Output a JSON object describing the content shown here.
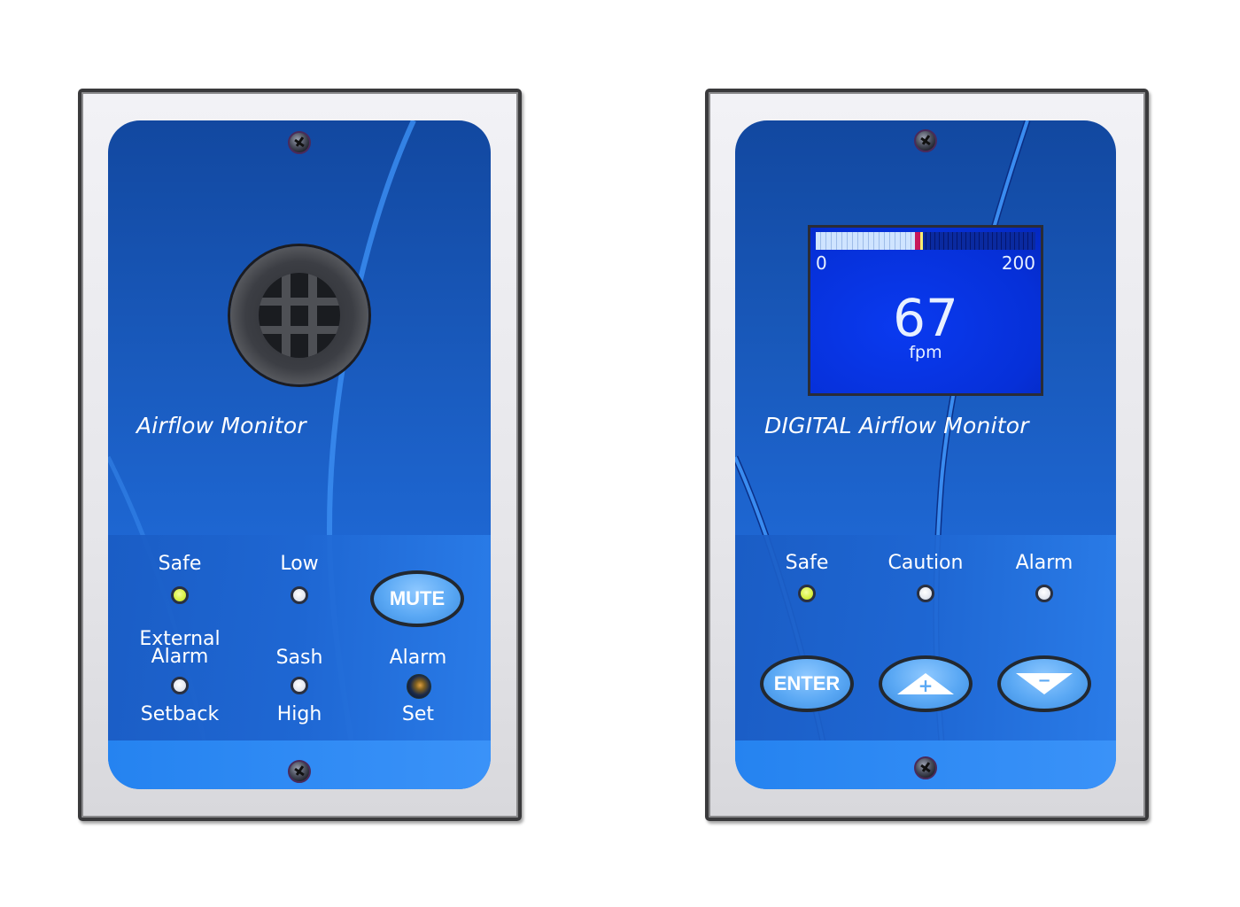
{
  "devices": [
    {
      "id": "analog",
      "title": "Airflow Monitor",
      "indicators_top": [
        {
          "label": "Safe",
          "state": "on"
        },
        {
          "label": "Low",
          "state": "off"
        }
      ],
      "mute_button": "MUTE",
      "indicators_bottom": [
        {
          "label_top": "External Alarm",
          "label_bottom": "Setback",
          "state": "off"
        },
        {
          "label_top": "Sash",
          "label_bottom": "High",
          "state": "off"
        }
      ],
      "alarm_set": {
        "label_top": "Alarm",
        "label_bottom": "Set"
      }
    },
    {
      "id": "digital",
      "title": "DIGITAL Airflow Monitor",
      "display": {
        "value": "67",
        "unit": "fpm",
        "scale_min": "0",
        "scale_max": "200",
        "reading": 67,
        "range_max": 200
      },
      "indicators": [
        {
          "label": "Safe",
          "state": "on"
        },
        {
          "label": "Caution",
          "state": "off"
        },
        {
          "label": "Alarm",
          "state": "off"
        }
      ],
      "buttons": {
        "enter": "ENTER",
        "up": "+",
        "down": "−"
      }
    }
  ],
  "colors": {
    "led_on": "#d8f040",
    "led_off": "#e4e8f0",
    "button_blue": "#5aa8f4",
    "face_blue": "#1a5cc0"
  }
}
